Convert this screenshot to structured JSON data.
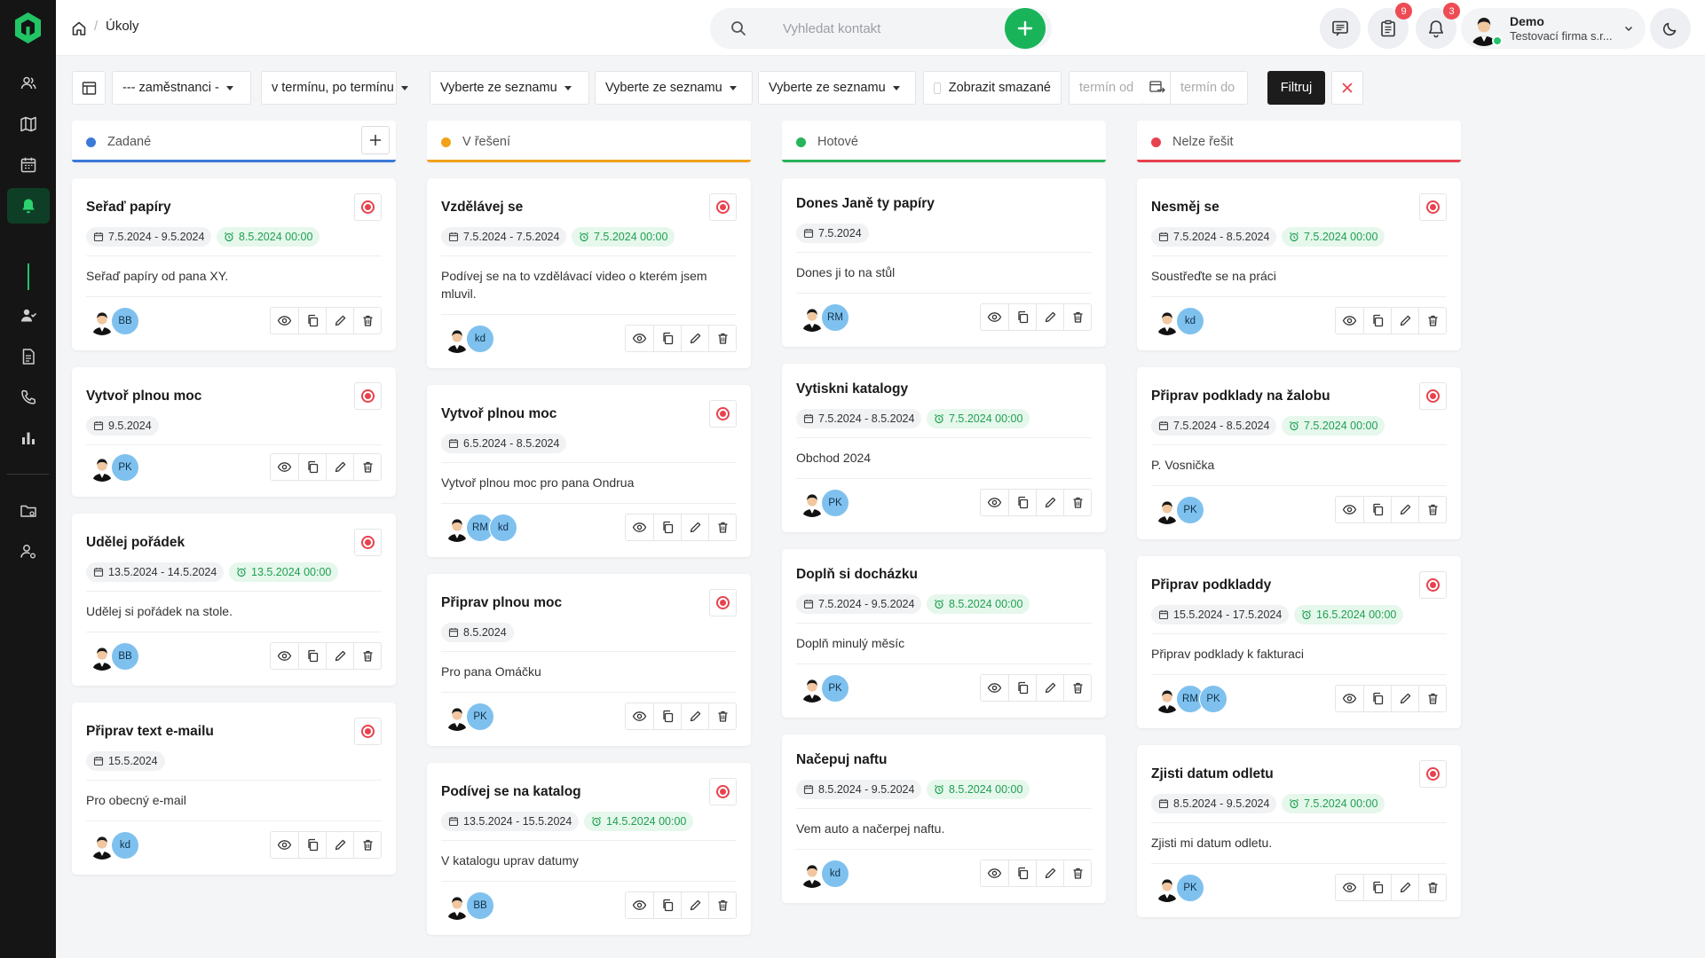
{
  "breadcrumb": {
    "current": "Úkoly"
  },
  "search": {
    "placeholder": "Vyhledat kontakt"
  },
  "header": {
    "notes_badge": "9",
    "notif_badge": "3",
    "user_name": "Demo",
    "company": "Testovací firma s.r..."
  },
  "filters": {
    "employees": "--- zaměstnanci -",
    "term": "v termínu, po termínu",
    "select1": "Vyberte ze seznamu",
    "select2": "Vyberte ze seznamu",
    "select3": "Vyberte ze seznamu",
    "show_deleted": "Zobrazit smazané",
    "date_from": "termín od",
    "date_to": "termín do",
    "filter_button": "Filtruj"
  },
  "colors": {
    "accent": "#19b45a",
    "zadane": "#3b79d9",
    "v_reseni": "#f0a21b",
    "hotove": "#27b45a",
    "nelze": "#e8424e"
  },
  "columns": [
    {
      "title": "Zadané",
      "cards": [
        {
          "title": "Seřaď papíry",
          "date": "7.5.2024 - 9.5.2024",
          "deadline": "8.5.2024 00:00",
          "desc": "Seřaď papíry od pana XY.",
          "users": [
            "BB"
          ]
        },
        {
          "title": "Vytvoř plnou moc",
          "date": "9.5.2024",
          "deadline": "",
          "desc": "",
          "users": [
            "PK"
          ]
        },
        {
          "title": "Udělej pořádek",
          "date": "13.5.2024 - 14.5.2024",
          "deadline": "13.5.2024 00:00",
          "desc": "Udělej si pořádek na stole.",
          "users": [
            "BB"
          ]
        },
        {
          "title": "Připrav text e-mailu",
          "date": "15.5.2024",
          "deadline": "",
          "desc": "Pro obecný e-mail",
          "users": [
            "kd"
          ]
        }
      ]
    },
    {
      "title": "V řešení",
      "cards": [
        {
          "title": "Vzdělávej se",
          "date": "7.5.2024 - 7.5.2024",
          "deadline": "7.5.2024 00:00",
          "desc": "Podívej se na to vzdělávací video o kterém jsem mluvil.",
          "users": [
            "kd"
          ]
        },
        {
          "title": "Vytvoř plnou moc",
          "date": "6.5.2024 - 8.5.2024",
          "deadline": "",
          "desc": "Vytvoř plnou moc pro pana Ondrua",
          "users": [
            "RM",
            "kd"
          ]
        },
        {
          "title": "Připrav plnou moc",
          "date": "8.5.2024",
          "deadline": "",
          "desc": "Pro pana Omáčku",
          "users": [
            "PK"
          ]
        },
        {
          "title": "Podívej se na katalog",
          "date": "13.5.2024 - 15.5.2024",
          "deadline": "14.5.2024 00:00",
          "desc": "V katalogu uprav datumy",
          "users": [
            "BB"
          ]
        }
      ]
    },
    {
      "title": "Hotové",
      "cards": [
        {
          "title": "Dones Janě ty papíry",
          "date": "7.5.2024",
          "deadline": "",
          "desc": "Dones ji to na stůl",
          "users": [
            "RM"
          ]
        },
        {
          "title": "Vytiskni katalogy",
          "date": "7.5.2024 - 8.5.2024",
          "deadline": "7.5.2024 00:00",
          "desc": "Obchod 2024",
          "users": [
            "PK"
          ]
        },
        {
          "title": "Doplň si docházku",
          "date": "7.5.2024 - 9.5.2024",
          "deadline": "8.5.2024 00:00",
          "desc": "Doplň minulý měsíc",
          "users": [
            "PK"
          ]
        },
        {
          "title": "Načepuj naftu",
          "date": "8.5.2024 - 9.5.2024",
          "deadline": "8.5.2024 00:00",
          "desc": "Vem auto a načerpej naftu.",
          "users": [
            "kd"
          ]
        }
      ]
    },
    {
      "title": "Nelze řešit",
      "cards": [
        {
          "title": "Nesměj se",
          "date": "7.5.2024 - 8.5.2024",
          "deadline": "7.5.2024 00:00",
          "desc": "Soustřeďte se na práci",
          "users": [
            "kd"
          ]
        },
        {
          "title": "Připrav podklady na žalobu",
          "date": "7.5.2024 - 8.5.2024",
          "deadline": "7.5.2024 00:00",
          "desc": "P. Vosnička",
          "users": [
            "PK"
          ]
        },
        {
          "title": "Připrav podkladdy",
          "date": "15.5.2024 - 17.5.2024",
          "deadline": "16.5.2024 00:00",
          "desc": "Připrav podklady k fakturaci",
          "users": [
            "RM",
            "PK"
          ]
        },
        {
          "title": "Zjisti datum odletu",
          "date": "8.5.2024 - 9.5.2024",
          "deadline": "7.5.2024 00:00",
          "desc": "Zjisti mi datum odletu.",
          "users": [
            "PK"
          ]
        }
      ]
    }
  ]
}
